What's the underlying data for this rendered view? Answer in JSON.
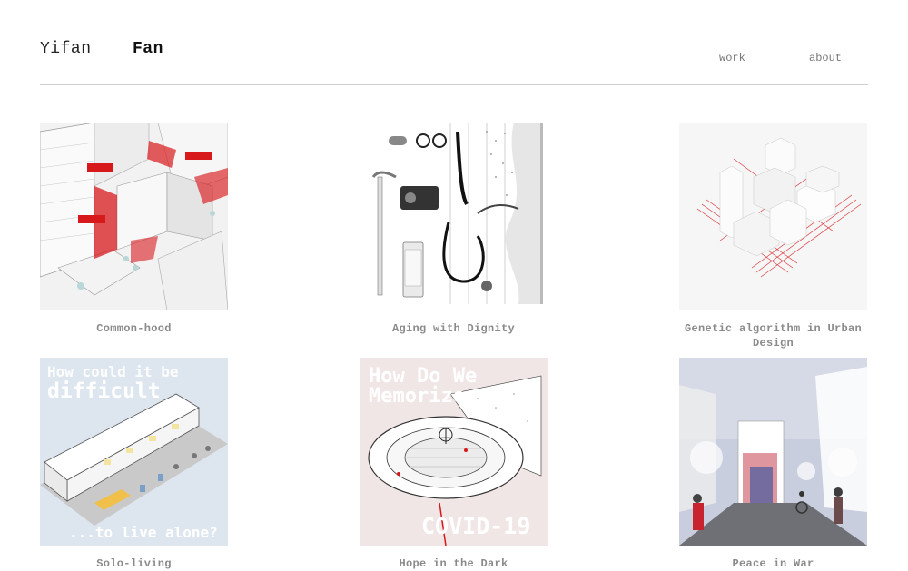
{
  "header": {
    "first_name": "Yifan",
    "last_name": "Fan",
    "nav": {
      "work": "work",
      "about": "about"
    }
  },
  "projects": [
    {
      "title": "Common-hood",
      "thumb_icon": "urban-axonometric-image"
    },
    {
      "title": "Aging with Dignity",
      "thumb_icon": "everyday-objects-collage-image"
    },
    {
      "title": "Genetic algorithm in Urban Design",
      "thumb_icon": "white-blocks-model-image"
    },
    {
      "title": "Solo-living",
      "thumb_icon": "housing-axonometric-image",
      "overlay": {
        "top1": "How could it be",
        "top2": "difficult",
        "bottom": "...to live alone?"
      }
    },
    {
      "title": "Hope in the Dark",
      "thumb_icon": "memorial-plan-image",
      "overlay": {
        "top1": "How Do We",
        "top2": "Memorize",
        "bottom": "COVID-19"
      }
    },
    {
      "title": "Peace in War",
      "thumb_icon": "street-rendering-image"
    }
  ],
  "colors": {
    "accent_red": "#d8191c",
    "caption_gray": "#8a8a8a",
    "solo_bg": "#dde6ef",
    "hope_bg": "#f1e6e6",
    "peace_bg": "#c9cede"
  }
}
